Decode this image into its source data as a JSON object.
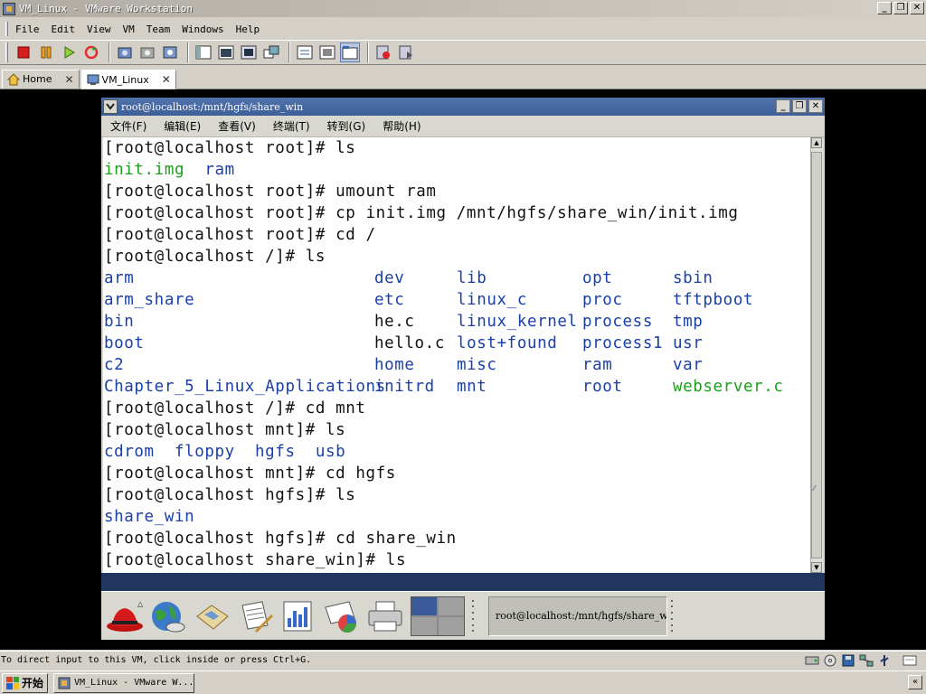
{
  "window": {
    "title": "VM_Linux - VMware Workstation",
    "controls": {
      "minimize": "_",
      "restore": "❐",
      "close": "✕"
    }
  },
  "menubar": [
    "File",
    "Edit",
    "View",
    "VM",
    "Team",
    "Windows",
    "Help"
  ],
  "toolbar": {
    "groups": [
      [
        "power-off-icon",
        "suspend-icon",
        "power-on-icon",
        "reset-icon"
      ],
      [
        "snapshot-icon",
        "revert-snapshot-icon",
        "snapshot-manager-icon"
      ],
      [
        "show-sidebar-icon",
        "quick-switch-icon",
        "full-screen-icon",
        "unity-icon"
      ],
      [
        "summary-view-icon",
        "console-view-icon",
        "show-tabs-icon"
      ],
      [
        "record-icon",
        "replay-icon"
      ]
    ]
  },
  "tabs": [
    {
      "label": "Home",
      "icon": "home-icon",
      "active": false
    },
    {
      "label": "VM_Linux",
      "icon": "vm-icon",
      "active": true
    }
  ],
  "guest": {
    "title": "root@localhost:/mnt/hgfs/share_win",
    "menus": [
      "文件(F)",
      "编辑(E)",
      "查看(V)",
      "终端(T)",
      "转到(G)",
      "帮助(H)"
    ],
    "terminal": {
      "lines": [
        {
          "type": "cmd",
          "text": "[root@localhost root]# ls"
        },
        {
          "type": "ls-green",
          "text": "init.img  ram",
          "parts": [
            {
              "t": "init.img",
              "c": "grn"
            },
            {
              "t": "  "
            },
            {
              "t": "ram",
              "c": "blu"
            }
          ]
        },
        {
          "type": "cmd",
          "text": "[root@localhost root]# umount ram"
        },
        {
          "type": "cmd",
          "text": "[root@localhost root]# cp init.img /mnt/hgfs/share_win/init.img"
        },
        {
          "type": "cmd",
          "text": "[root@localhost root]# cd /"
        },
        {
          "type": "cmd",
          "text": "[root@localhost /]# ls"
        }
      ],
      "ls_root": [
        [
          "arm",
          "dev",
          "lib",
          "opt",
          "sbin"
        ],
        [
          "arm_share",
          "etc",
          "linux_c",
          "proc",
          "tftpboot"
        ],
        [
          "bin",
          "he.c",
          "linux_kernel",
          "process",
          "tmp"
        ],
        [
          "boot",
          "hello.c",
          "lost+found",
          "process1",
          "usr"
        ],
        [
          "c2",
          "home",
          "misc",
          "ram",
          "var"
        ],
        [
          "Chapter_5_Linux_Applications",
          "initrd",
          "mnt",
          "root",
          "webserver.c"
        ]
      ],
      "ls_root_colors": [
        [
          "blu",
          "blu",
          "blu",
          "blu",
          "blu"
        ],
        [
          "blu",
          "blu",
          "blu",
          "blu",
          "blu"
        ],
        [
          "blu",
          "blk",
          "blu",
          "blu",
          "blu"
        ],
        [
          "blu",
          "blk",
          "blu",
          "blu",
          "blu"
        ],
        [
          "blu",
          "blu",
          "blu",
          "blu",
          "blu"
        ],
        [
          "blu",
          "blu",
          "blu",
          "blu",
          "grn"
        ]
      ],
      "lines_after": [
        {
          "type": "cmd",
          "text": "[root@localhost /]# cd mnt"
        },
        {
          "type": "cmd",
          "text": "[root@localhost mnt]# ls"
        },
        {
          "type": "dir",
          "text": "cdrom  floppy  hgfs  usb"
        },
        {
          "type": "cmd",
          "text": "[root@localhost mnt]# cd hgfs"
        },
        {
          "type": "cmd",
          "text": "[root@localhost hgfs]# ls"
        },
        {
          "type": "dir",
          "text": "share_win"
        },
        {
          "type": "cmd",
          "text": "[root@localhost hgfs]# cd share_win"
        },
        {
          "type": "cmd",
          "text": "[root@localhost share_win]# ls"
        }
      ]
    },
    "panel": {
      "launchers": [
        "redhat-menu-icon",
        "web-browser-icon",
        "email-icon",
        "writer-icon",
        "spreadsheet-icon",
        "presentation-icon",
        "printer-icon"
      ],
      "task_label": "root@localhost:/mnt/hgfs/share_win"
    }
  },
  "status": {
    "text": "To direct input to this VM, click inside or press Ctrl+G.",
    "icons": [
      "hard-disk-icon",
      "cd-rom-icon",
      "floppy-icon",
      "network-icon",
      "usb-icon",
      "message-icon"
    ]
  },
  "taskbar": {
    "start_label": "开始",
    "task_label": "VM_Linux - VMware W...",
    "tray": "«"
  },
  "colors": {
    "terminal_blue": "#1a3fa8",
    "terminal_green": "#1aa01a",
    "guest_title": "#3e5f99",
    "panel_strip": "#20365e"
  }
}
